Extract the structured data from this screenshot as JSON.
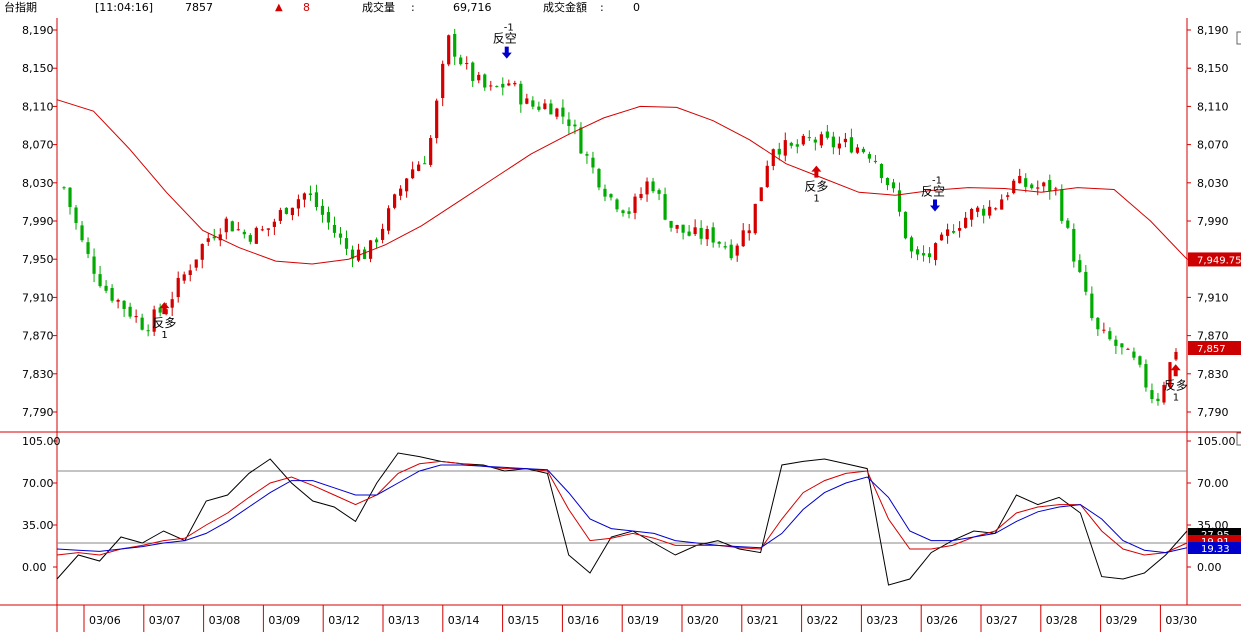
{
  "header": {
    "symbol": "台指期",
    "time": "[11:04:16]",
    "price": "7857",
    "change_arrow": "▲",
    "change": "8",
    "volume_label": "成交量",
    "volume_sep": ":",
    "volume": "69,716",
    "amount_label": "成交金額",
    "amount_sep": ":",
    "amount": "0"
  },
  "colors": {
    "up": "#d40000",
    "down": "#00aa00",
    "ma": "#d40000",
    "k": "#000000",
    "d": "#d40000",
    "j": "#0000cc",
    "ref": "#888888",
    "axis": "#d40000",
    "price_box": "#cc0000"
  },
  "chart_data": [
    {
      "type": "candlestick",
      "title": "",
      "ylim": [
        7770,
        8210
      ],
      "yticks": [
        "8,190",
        "8,150",
        "8,110",
        "8,070",
        "8,030",
        "7,990",
        "7,950",
        "7,910",
        "7,870",
        "7,830",
        "7,790"
      ],
      "ytick_values": [
        8190,
        8150,
        8110,
        8070,
        8030,
        7990,
        7950,
        7910,
        7870,
        7830,
        7790
      ],
      "x_dates": [
        "03/06",
        "03/07",
        "03/08",
        "03/09",
        "03/12",
        "03/13",
        "03/14",
        "03/15",
        "03/16",
        "03/19",
        "03/20",
        "03/21",
        "03/22",
        "03/23",
        "03/26",
        "03/27",
        "03/28",
        "03/29",
        "03/30"
      ],
      "close_guide": [
        8025,
        7960,
        7920,
        7900,
        7880,
        7900,
        7935,
        7970,
        7990,
        7975,
        7980,
        8005,
        8020,
        7990,
        7960,
        7955,
        7995,
        8040,
        8060,
        8180,
        8145,
        8125,
        8135,
        8110,
        8112,
        8095,
        8050,
        8015,
        8000,
        8035,
        7985,
        7975,
        7975,
        7960,
        7990,
        8070,
        8065,
        8075,
        8070,
        8070,
        8060,
        8020,
        7950,
        7955,
        7985,
        8000,
        8005,
        8030,
        8025,
        8025,
        7950,
        7875,
        7860,
        7840,
        7800,
        7857
      ],
      "ma_line": [
        8117,
        8105,
        8065,
        8020,
        7980,
        7962,
        7948,
        7945,
        7950,
        7965,
        7985,
        8010,
        8035,
        8060,
        8080,
        8098,
        8110,
        8109,
        8095,
        8075,
        8050,
        8035,
        8020,
        8017,
        8022,
        8025,
        8024,
        8020,
        8025,
        8023,
        7990,
        7950
      ],
      "ma_label": "7,949.75",
      "price_label": "7,857",
      "signals": [
        {
          "kind": "long",
          "label": "反多",
          "num": "1",
          "x_pct": 0.095,
          "price": 7905
        },
        {
          "kind": "short",
          "label": "反空",
          "num": "-1",
          "x_pct": 0.398,
          "price": 8160
        },
        {
          "kind": "long",
          "label": "反多",
          "num": "1",
          "x_pct": 0.672,
          "price": 8048
        },
        {
          "kind": "short",
          "label": "反空",
          "num": "-1",
          "x_pct": 0.777,
          "price": 8000
        },
        {
          "kind": "long",
          "label": "反多",
          "num": "1",
          "x_pct": 0.99,
          "price": 7840
        }
      ]
    },
    {
      "type": "line",
      "title": "",
      "ylim": [
        -45,
        115
      ],
      "yticks": [
        "105.00",
        "70.00",
        "35.00",
        "0.00"
      ],
      "ytick_values": [
        105,
        70,
        35,
        0
      ],
      "ref_lines": [
        80,
        20
      ],
      "series": [
        {
          "name": "",
          "values": [
            -10,
            10,
            5,
            25,
            20,
            30,
            22,
            55,
            60,
            78,
            90,
            70,
            55,
            50,
            38,
            70,
            95,
            92,
            88,
            86,
            85,
            80,
            82,
            78,
            10,
            -5,
            25,
            30,
            20,
            10,
            18,
            22,
            15,
            12,
            85,
            88,
            90,
            86,
            82,
            -15,
            -10,
            12,
            22,
            30,
            28,
            60,
            52,
            58,
            45,
            -8,
            -10,
            -5,
            10,
            30
          ]
        },
        {
          "name": "",
          "values": [
            10,
            12,
            10,
            15,
            18,
            22,
            24,
            35,
            45,
            58,
            70,
            75,
            68,
            60,
            52,
            60,
            78,
            86,
            88,
            86,
            84,
            82,
            82,
            80,
            48,
            22,
            24,
            28,
            24,
            18,
            18,
            18,
            16,
            15,
            40,
            62,
            72,
            78,
            80,
            40,
            15,
            15,
            18,
            25,
            30,
            45,
            50,
            52,
            52,
            30,
            15,
            10,
            12,
            20
          ]
        },
        {
          "name": "",
          "values": [
            15,
            14,
            13,
            15,
            17,
            20,
            22,
            28,
            38,
            50,
            62,
            72,
            72,
            66,
            60,
            60,
            70,
            80,
            85,
            85,
            84,
            83,
            82,
            81,
            62,
            40,
            32,
            30,
            28,
            22,
            20,
            18,
            17,
            16,
            28,
            48,
            62,
            70,
            75,
            58,
            30,
            22,
            22,
            25,
            28,
            38,
            46,
            50,
            52,
            40,
            22,
            14,
            12,
            16
          ]
        }
      ],
      "series_labels": [
        "27.95",
        "19.91",
        "19.33"
      ]
    }
  ]
}
